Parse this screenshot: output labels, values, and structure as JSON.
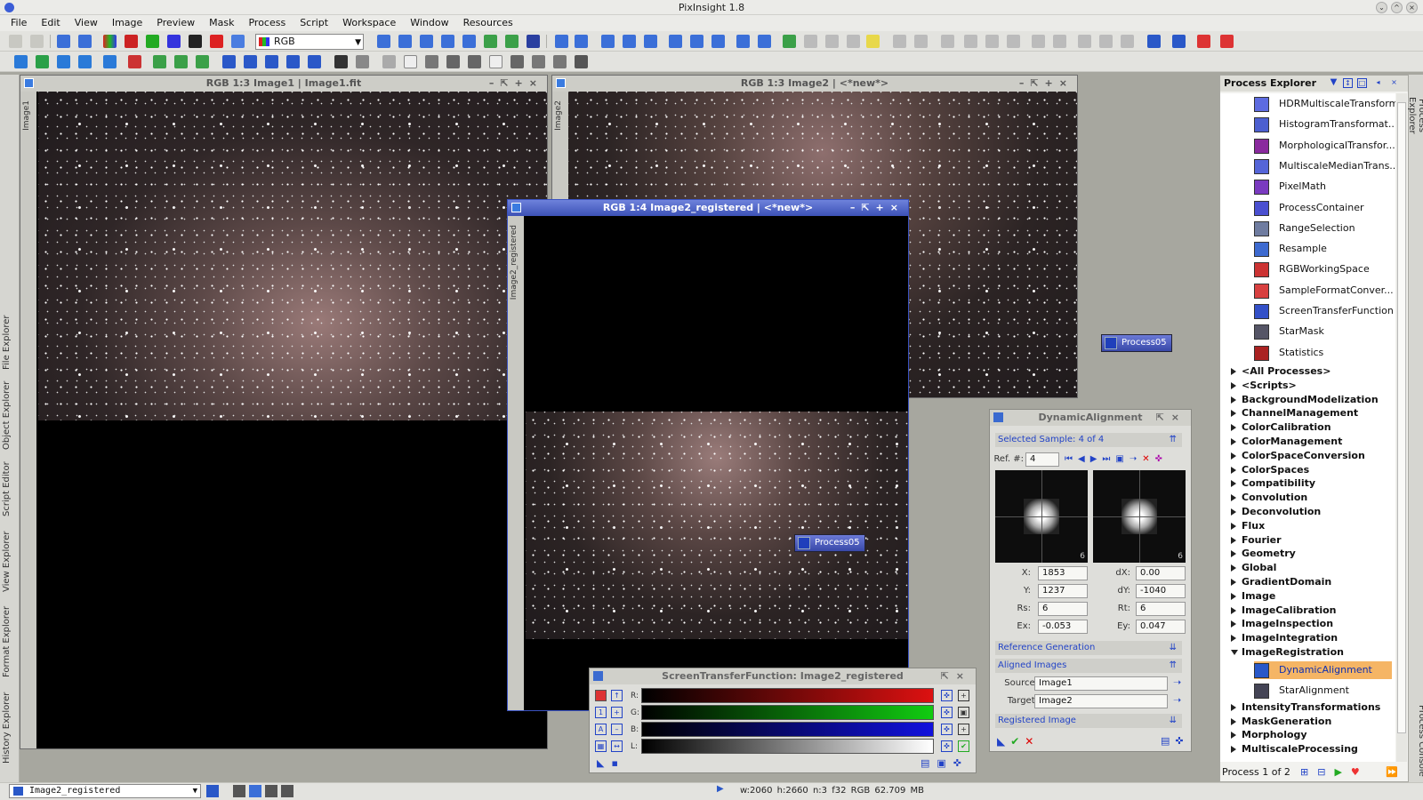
{
  "app": {
    "title": "PixInsight 1.8"
  },
  "menu": [
    "File",
    "Edit",
    "View",
    "Image",
    "Preview",
    "Mask",
    "Process",
    "Script",
    "Workspace",
    "Window",
    "Resources"
  ],
  "toolbar": {
    "color_space": "RGB"
  },
  "left_tabs": [
    "File Explorer",
    "Object Explorer",
    "Script Editor",
    "View Explorer",
    "Format Explorer",
    "History Explorer"
  ],
  "right_tabs": [
    "Process Explorer",
    "Process Console"
  ],
  "windows": {
    "image1": {
      "title": "RGB 1:3 Image1 | Image1.fit",
      "side": "Image1"
    },
    "image2": {
      "title": "RGB 1:3 Image2 | <*new*>",
      "side": "Image2"
    },
    "registered": {
      "title": "RGB 1:4 Image2_registered | <*new*>",
      "side": "Image2_registered"
    }
  },
  "process_icons": {
    "a": "Process05",
    "b": "Process05"
  },
  "process_explorer": {
    "title": "Process Explorer",
    "items": [
      {
        "label": "HDRMultiscaleTransform",
        "color": "#5d6be0"
      },
      {
        "label": "HistogramTransformat...",
        "color": "#4c5fd0"
      },
      {
        "label": "MorphologicalTransfor...",
        "color": "#8a2a9e"
      },
      {
        "label": "MultiscaleMedianTrans...",
        "color": "#5565d8"
      },
      {
        "label": "PixelMath",
        "color": "#7a3ac0"
      },
      {
        "label": "ProcessContainer",
        "color": "#4a4fd0"
      },
      {
        "label": "RangeSelection",
        "color": "#6f7ca0"
      },
      {
        "label": "Resample",
        "color": "#3d6ad0"
      },
      {
        "label": "RGBWorkingSpace",
        "color": "#c33"
      },
      {
        "label": "SampleFormatConver...",
        "color": "#d84040"
      },
      {
        "label": "ScreenTransferFunction",
        "color": "#3350c8"
      },
      {
        "label": "StarMask",
        "color": "#556"
      },
      {
        "label": "Statistics",
        "color": "#a22"
      }
    ],
    "categories": [
      "<All Processes>",
      "<Scripts>",
      "BackgroundModelization",
      "ChannelManagement",
      "ColorCalibration",
      "ColorManagement",
      "ColorSpaceConversion",
      "ColorSpaces",
      "Compatibility",
      "Convolution",
      "Deconvolution",
      "Flux",
      "Fourier",
      "Geometry",
      "Global",
      "GradientDomain",
      "Image",
      "ImageCalibration",
      "ImageInspection",
      "ImageIntegration",
      "ImageRegistration"
    ],
    "sub_items": [
      {
        "label": "DynamicAlignment",
        "selected": true
      },
      {
        "label": "StarAlignment",
        "selected": false
      }
    ],
    "more_categories": [
      "IntensityTransformations",
      "MaskGeneration",
      "Morphology",
      "MultiscaleProcessing"
    ],
    "footer": "Process 1 of 2"
  },
  "dynamic_alignment": {
    "title": "DynamicAlignment",
    "selected_sample": "Selected Sample: 4 of 4",
    "ref_label": "Ref. #:",
    "ref_value": "4",
    "thumb_a": "6",
    "thumb_b": "6",
    "x_label": "X:",
    "x": "1853",
    "dx_label": "dX:",
    "dx": "0.00",
    "y_label": "Y:",
    "y": "1237",
    "dy_label": "dY:",
    "dy": "-1040",
    "rs_label": "Rs:",
    "rs": "6",
    "rt_label": "Rt:",
    "rt": "6",
    "ex_label": "Ex:",
    "ex": "-0.053",
    "ey_label": "Ey:",
    "ey": "0.047",
    "reference_generation": "Reference Generation",
    "aligned_images": "Aligned Images",
    "source_label": "Source:",
    "source": "Image1",
    "target_label": "Target:",
    "target": "Image2",
    "registered_image": "Registered Image"
  },
  "stf": {
    "title": "ScreenTransferFunction: Image2_registered",
    "channels": [
      "R:",
      "G:",
      "B:",
      "L:"
    ]
  },
  "status": {
    "view": "Image2_registered",
    "info": "w:2060   h:2660   n:3   f32   RGB   62.709 MB"
  }
}
